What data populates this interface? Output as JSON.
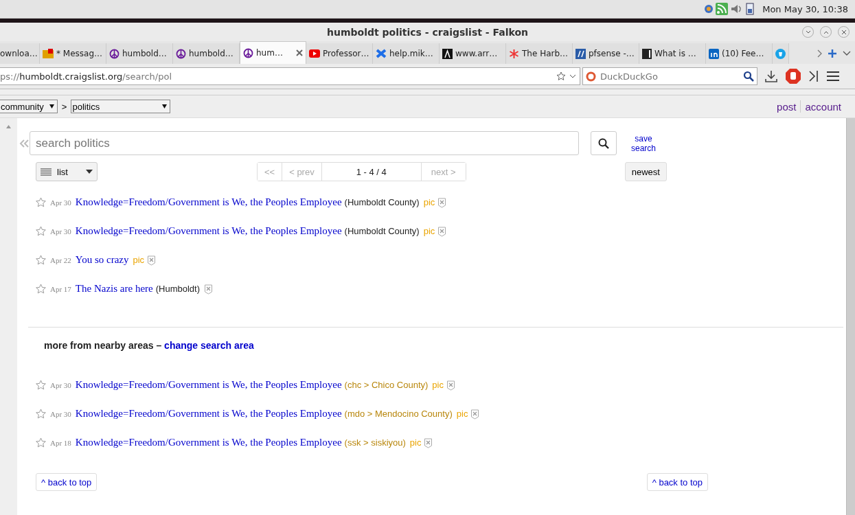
{
  "panel": {
    "clock": "Mon May 30, 10:38"
  },
  "window": {
    "title": "humboldt politics - craigslist - Falkon"
  },
  "tabs": [
    {
      "label": "ownloa…",
      "selected": false
    },
    {
      "label": "* Messag…",
      "selected": false
    },
    {
      "label": "humbold…",
      "selected": false
    },
    {
      "label": "humbold…",
      "selected": false
    },
    {
      "label": "hum…",
      "selected": true
    },
    {
      "label": "Professor…",
      "selected": false
    },
    {
      "label": "help.mik…",
      "selected": false
    },
    {
      "label": "www.arr…",
      "selected": false
    },
    {
      "label": "The Harb…",
      "selected": false
    },
    {
      "label": "pfsense -…",
      "selected": false
    },
    {
      "label": "What is …",
      "selected": false
    },
    {
      "label": "(10) Fee…",
      "selected": false
    },
    {
      "selected": false
    }
  ],
  "address": {
    "scheme": "ps://",
    "host": "humboldt.craigslist.org",
    "path": "/search/pol"
  },
  "search_engine": {
    "placeholder": "DuckDuckGo"
  },
  "breadcrumb": {
    "area": "community",
    "separator": ">",
    "category": "politics"
  },
  "header_links": [
    "post",
    "account"
  ],
  "search": {
    "placeholder": "search politics",
    "save_label": "save search"
  },
  "view_select": "list",
  "pagination": [
    {
      "label": "<<",
      "disabled": true
    },
    {
      "label": "< prev",
      "disabled": true
    },
    {
      "label": "1 - 4 / 4",
      "disabled": false,
      "kind": "range"
    },
    {
      "label": "next >",
      "disabled": true
    }
  ],
  "sort": "newest",
  "results": [
    {
      "date": "Apr 30",
      "title": "Knowledge=Freedom/Government is We, the Peoples Employee",
      "location": "(Humboldt County)",
      "pic": "pic"
    },
    {
      "date": "Apr 30",
      "title": "Knowledge=Freedom/Government is We, the Peoples Employee",
      "location": "(Humboldt County)",
      "pic": "pic"
    },
    {
      "date": "Apr 22",
      "title": "You so crazy",
      "pic": "pic"
    },
    {
      "date": "Apr 17",
      "title": "The Nazis are here",
      "location": "(Humboldt)"
    }
  ],
  "nearby": {
    "heading": "more from nearby areas –",
    "link": "change search area",
    "results": [
      {
        "date": "Apr 30",
        "title": "Knowledge=Freedom/Government is We, the Peoples Employee",
        "location": "(chc > Chico County)",
        "pic": "pic"
      },
      {
        "date": "Apr 30",
        "title": "Knowledge=Freedom/Government is We, the Peoples Employee",
        "location": "(mdo > Mendocino County)",
        "pic": "pic"
      },
      {
        "date": "Apr 18",
        "title": "Knowledge=Freedom/Government is We, the Peoples Employee",
        "location": "(ssk > siskiyou)",
        "pic": "pic"
      }
    ]
  },
  "back_to_top": [
    "^ back to top",
    "^ back to top"
  ]
}
